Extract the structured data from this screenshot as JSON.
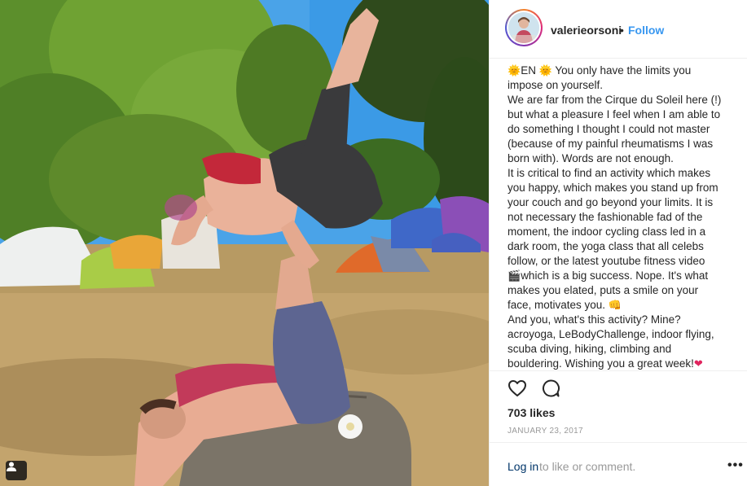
{
  "post": {
    "username": "valerieorsoni",
    "dot": "•",
    "follow_label": "Follow",
    "caption_lines": [
      "EN  You only have the limits you",
      "impose on yourself.",
      "We are far from the Cirque du Soleil here (!)",
      "but what a pleasure I feel when I am able to",
      "do something I thought I could not master",
      "(because of my painful rheumatisms I was",
      "born with). Words are not enough.",
      "It is critical to find an activity which makes",
      "you happy, which makes you stand up from",
      "your couch and go beyond your limits. It is",
      "not necessary the fashionable fad of the",
      "moment, the indoor cycling class led in a",
      "dark room, the yoga class that all celebs",
      "follow, or the latest youtube fitness video",
      "which is a big success. Nope. It's what",
      "makes you elated, puts a smile on your",
      "face, motivates you.",
      "And you, what's this activity? Mine?",
      "acroyoga, LeBodyChallenge, indoor flying,",
      "scuba diving, hiking, climbing and",
      "bouldering. Wishing you a great week!"
    ],
    "emojis": {
      "sun": "🌞",
      "clapper": "🎬",
      "smile": "😊",
      "fist": "👊",
      "heart": "❤"
    },
    "likes": "703 likes",
    "date": "JANUARY 23, 2017",
    "login_link": "Log in",
    "login_rest": "to like or comment.",
    "more_label": "•••"
  },
  "colors": {
    "accent": "#3897f0",
    "text": "#262626",
    "muted": "#999999",
    "link_dark": "#003569"
  },
  "icons": {
    "like": "heart-outline-icon",
    "comment": "speech-bubble-icon",
    "user_tag": "person-icon"
  }
}
